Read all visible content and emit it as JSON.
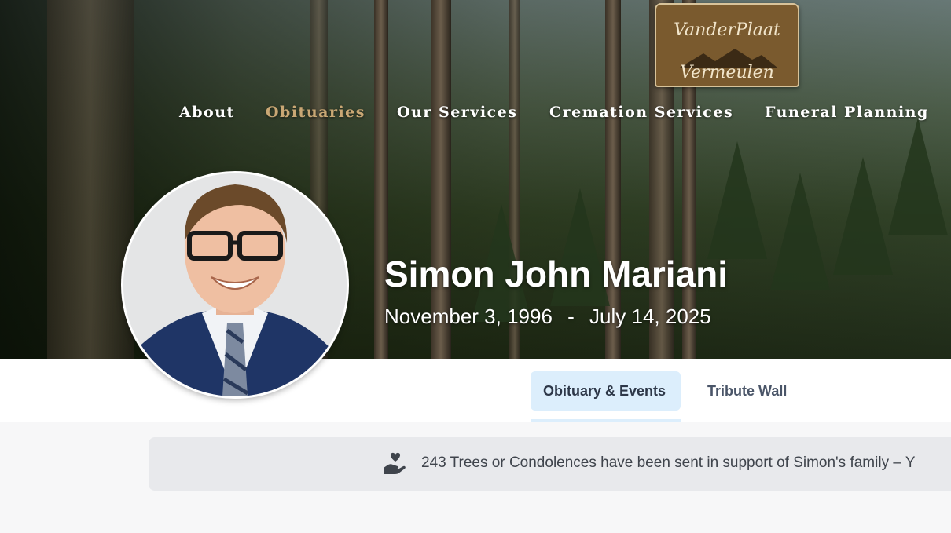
{
  "logo": {
    "line1": "VanderPlaat",
    "line2": "Vermeulen"
  },
  "nav": {
    "items": [
      {
        "label": "About",
        "active": false
      },
      {
        "label": "Obituaries",
        "active": true
      },
      {
        "label": "Our Services",
        "active": false
      },
      {
        "label": "Cremation Services",
        "active": false
      },
      {
        "label": "Funeral Planning",
        "active": false
      }
    ]
  },
  "profile": {
    "name": "Simon John Mariani",
    "born": "November 3, 1996",
    "separator": "-",
    "died": "July 14, 2025"
  },
  "tabs": [
    {
      "label": "Obituary & Events",
      "active": true
    },
    {
      "label": "Tribute Wall",
      "active": false
    }
  ],
  "banner": {
    "icon": "hand-heart-icon",
    "text": "243 Trees or Condolences have been sent in support of Simon's family – Y"
  },
  "colors": {
    "nav_active": "#c9a774",
    "tab_active_bg": "#dceefc",
    "logo_bg": "#7a5a2e",
    "banner_bg": "#e8e9ec"
  }
}
